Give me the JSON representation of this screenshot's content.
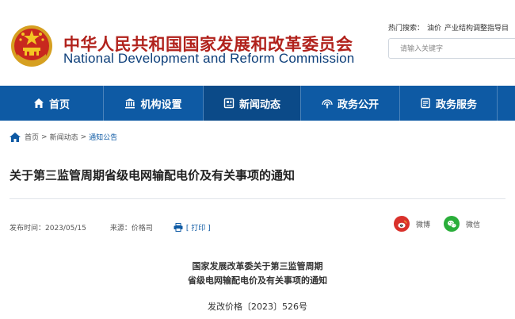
{
  "header": {
    "site_name_cn": "中华人民共和国国家发展和改革委员会",
    "site_name_en": "National Development and Reform Commission",
    "hot_search_label": "热门搜索：",
    "hot_search_items": [
      "油价",
      "产业结构调整指导目"
    ],
    "search_placeholder": "请输入关键字"
  },
  "nav": {
    "items": [
      {
        "label": "首页",
        "icon": "home-icon"
      },
      {
        "label": "机构设置",
        "icon": "building-icon"
      },
      {
        "label": "新闻动态",
        "icon": "news-icon"
      },
      {
        "label": "政务公开",
        "icon": "broadcast-icon"
      },
      {
        "label": "政务服务",
        "icon": "service-icon"
      }
    ],
    "active_index": 2
  },
  "breadcrumb": {
    "items": [
      "首页",
      "新闻动态",
      "通知公告"
    ],
    "separator": ">"
  },
  "article": {
    "title": "关于第三监管周期省级电网输配电价及有关事项的通知",
    "publish_label": "发布时间：2023/05/15",
    "source_label": "来源：价格司",
    "print_label": "[ 打印 ]",
    "share_weibo": "微博",
    "share_wechat": "微信",
    "doc_title_line1": "国家发展改革委关于第三监管周期",
    "doc_title_line2": "省级电网输配电价及有关事项的通知",
    "doc_number": "发改价格〔2023〕526号"
  },
  "colors": {
    "brand_red": "#b1221c",
    "brand_blue": "#0e5aa4",
    "nav_active": "#0b4a88",
    "weibo_red": "#d9312b",
    "wechat_green": "#2aae3a"
  }
}
